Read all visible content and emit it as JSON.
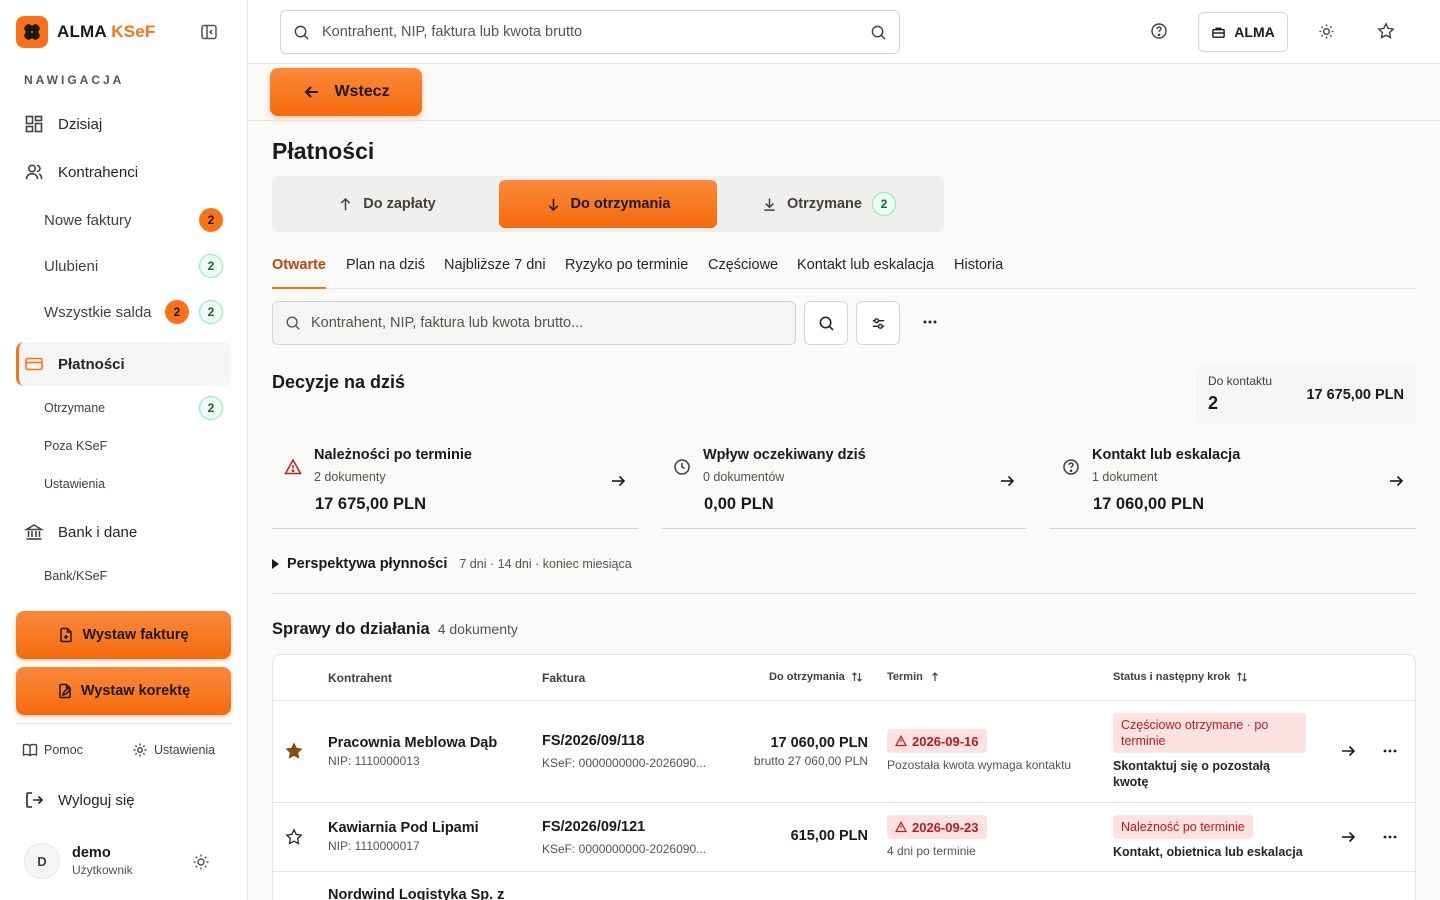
{
  "brand": {
    "name": "ALMA",
    "accent": "KSeF"
  },
  "sidebar": {
    "heading": "NAWIGACJA",
    "items": [
      {
        "label": "Dzisiaj"
      },
      {
        "label": "Kontrahenci"
      },
      {
        "label": "Nowe faktury",
        "badge_orange": "2"
      },
      {
        "label": "Ulubieni",
        "badge_green": "2"
      },
      {
        "label": "Wszystkie salda",
        "badge_orange": "2",
        "badge_green": "2"
      },
      {
        "label": "Płatności"
      },
      {
        "label": "Otrzymane",
        "badge_green": "2"
      },
      {
        "label": "Poza KSeF"
      },
      {
        "label": "Ustawienia"
      },
      {
        "label": "Bank i dane"
      },
      {
        "label": "Bank/KSeF"
      }
    ],
    "cta_invoice": "Wystaw fakturę",
    "cta_correction": "Wystaw korektę",
    "help": "Pomoc",
    "settings": "Ustawienia",
    "logout": "Wyloguj się",
    "user": {
      "initial": "D",
      "name": "demo",
      "role": "Użytkownik"
    }
  },
  "topbar": {
    "search_placeholder": "Kontrahent, NIP, faktura lub kwota brutto",
    "org_button": "ALMA"
  },
  "back_button": "Wstecz",
  "page_title": "Płatności",
  "segments": [
    {
      "label": "Do zapłaty"
    },
    {
      "label": "Do otrzymania"
    },
    {
      "label": "Otrzymane",
      "badge": "2"
    }
  ],
  "tabs": [
    "Otwarte",
    "Plan na dziś",
    "Najbliższe 7 dni",
    "Ryzyko po terminie",
    "Częściowe",
    "Kontakt lub eskalacja",
    "Historia"
  ],
  "filter": {
    "placeholder": "Kontrahent, NIP, faktura lub kwota brutto..."
  },
  "decisions": {
    "title": "Decyzje na dziś",
    "contact_label": "Do kontaktu",
    "contact_count": "2",
    "contact_amount": "17 675,00 PLN",
    "cards": [
      {
        "title": "Należności po terminie",
        "sub": "2 dokumenty",
        "value": "17 675,00 PLN"
      },
      {
        "title": "Wpływ oczekiwany dziś",
        "sub": "0 dokumentów",
        "value": "0,00 PLN"
      },
      {
        "title": "Kontakt lub eskalacja",
        "sub": "1 dokument",
        "value": "17 060,00 PLN"
      }
    ]
  },
  "perspective": {
    "title": "Perspektywa płynności",
    "meta": "7 dni · 14 dni · koniec miesiąca"
  },
  "cases": {
    "title": "Sprawy do działania",
    "count": "4 dokumenty",
    "columns": [
      "Kontrahent",
      "Faktura",
      "Do otrzymania",
      "Termin",
      "Status i następny krok"
    ],
    "rows": [
      {
        "name": "Pracownia Meblowa Dąb",
        "nip": "NIP: 1110000013",
        "invoice": "FS/2026/09/118",
        "ksef": "KSeF: 0000000000-2026090...",
        "amount": "17 060,00 PLN",
        "gross": "brutto 27 060,00 PLN",
        "date": "2026-09-16",
        "date_note": "Pozostała kwota wymaga kontaktu",
        "status": "Częściowo otrzymane · po terminie",
        "next": "Skontaktuj się o pozostałą kwotę",
        "favorite": true
      },
      {
        "name": "Kawiarnia Pod Lipami",
        "nip": "NIP: 1110000017",
        "invoice": "FS/2026/09/121",
        "ksef": "KSeF: 0000000000-2026090...",
        "amount": "615,00 PLN",
        "gross": "",
        "date": "2026-09-23",
        "date_note": "4 dni po terminie",
        "status": "Należność po terminie",
        "next": "Kontakt, obietnica lub eskalacja",
        "favorite": false
      },
      {
        "name": "Nordwind Logistyka Sp. z",
        "nip": "",
        "invoice": "",
        "ksef": "",
        "amount": "",
        "gross": "",
        "date": "",
        "date_note": "",
        "status": "",
        "next": "",
        "favorite": false
      }
    ]
  }
}
